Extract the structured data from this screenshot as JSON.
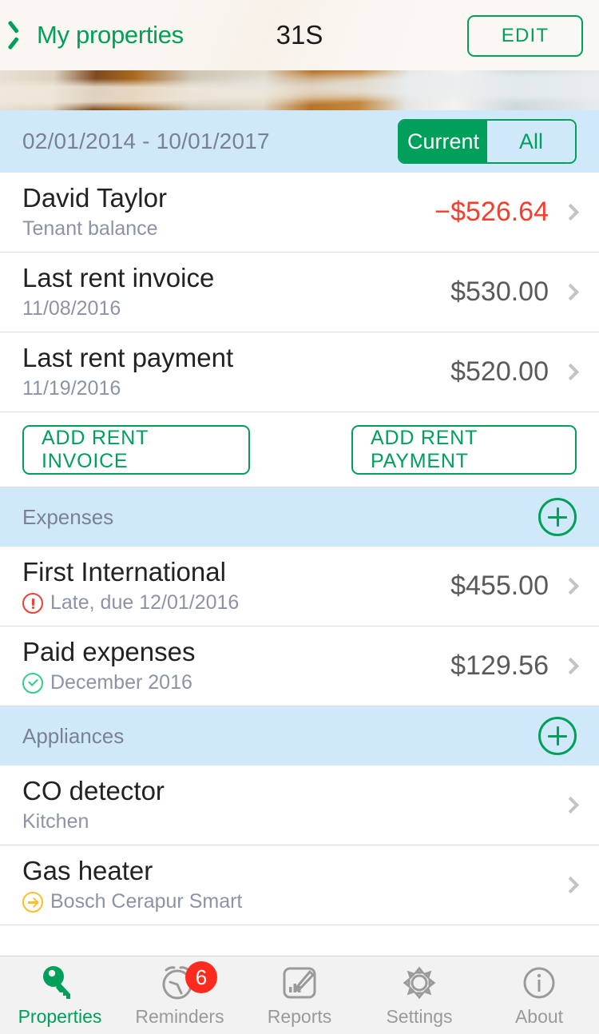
{
  "navbar": {
    "back_label": "My properties",
    "title": "31S",
    "edit_label": "EDIT"
  },
  "period_bar": {
    "range": "02/01/2014 - 10/01/2017",
    "segments": [
      {
        "label": "Current",
        "active": true
      },
      {
        "label": "All",
        "active": false
      }
    ]
  },
  "tenant_section": {
    "rows": [
      {
        "title": "David Taylor",
        "subtitle": "Tenant balance",
        "amount": "−$526.64",
        "negative": true,
        "icon": ""
      },
      {
        "title": "Last rent invoice",
        "subtitle": "11/08/2016",
        "amount": "$530.00",
        "negative": false,
        "icon": ""
      },
      {
        "title": "Last rent payment",
        "subtitle": "11/19/2016",
        "amount": "$520.00",
        "negative": false,
        "icon": ""
      }
    ],
    "actions": {
      "add_invoice_label": "ADD RENT INVOICE",
      "add_payment_label": "ADD RENT PAYMENT"
    }
  },
  "expenses_section": {
    "title": "Expenses",
    "add_icon": "plus-icon",
    "rows": [
      {
        "title": "First International",
        "subtitle": "Late, due 12/01/2016",
        "amount": "$455.00",
        "icon": "alert-icon"
      },
      {
        "title": "Paid expenses",
        "subtitle": "December 2016",
        "amount": "$129.56",
        "icon": "check-icon"
      }
    ]
  },
  "appliances_section": {
    "title": "Appliances",
    "add_icon": "plus-icon",
    "rows": [
      {
        "title": "CO detector",
        "subtitle": "Kitchen",
        "amount": "",
        "icon": ""
      },
      {
        "title": "Gas heater",
        "subtitle": "Bosch Cerapur Smart",
        "amount": "",
        "icon": "arrow-circle-icon"
      }
    ]
  },
  "tabbar": {
    "tabs": [
      {
        "label": "Properties",
        "icon": "key-icon",
        "active": true,
        "badge": ""
      },
      {
        "label": "Reminders",
        "icon": "alarm-clock-icon",
        "active": false,
        "badge": "6"
      },
      {
        "label": "Reports",
        "icon": "report-pencil-icon",
        "active": false,
        "badge": ""
      },
      {
        "label": "Settings",
        "icon": "gear-icon",
        "active": false,
        "badge": ""
      },
      {
        "label": "About",
        "icon": "info-icon",
        "active": false,
        "badge": ""
      }
    ]
  },
  "colors": {
    "brand_green": "#00a05a",
    "section_blue": "#cfe9fb",
    "negative_red": "#fb3b2b",
    "badge_red": "#fb2c1e",
    "muted_text": "#8d93a6"
  }
}
